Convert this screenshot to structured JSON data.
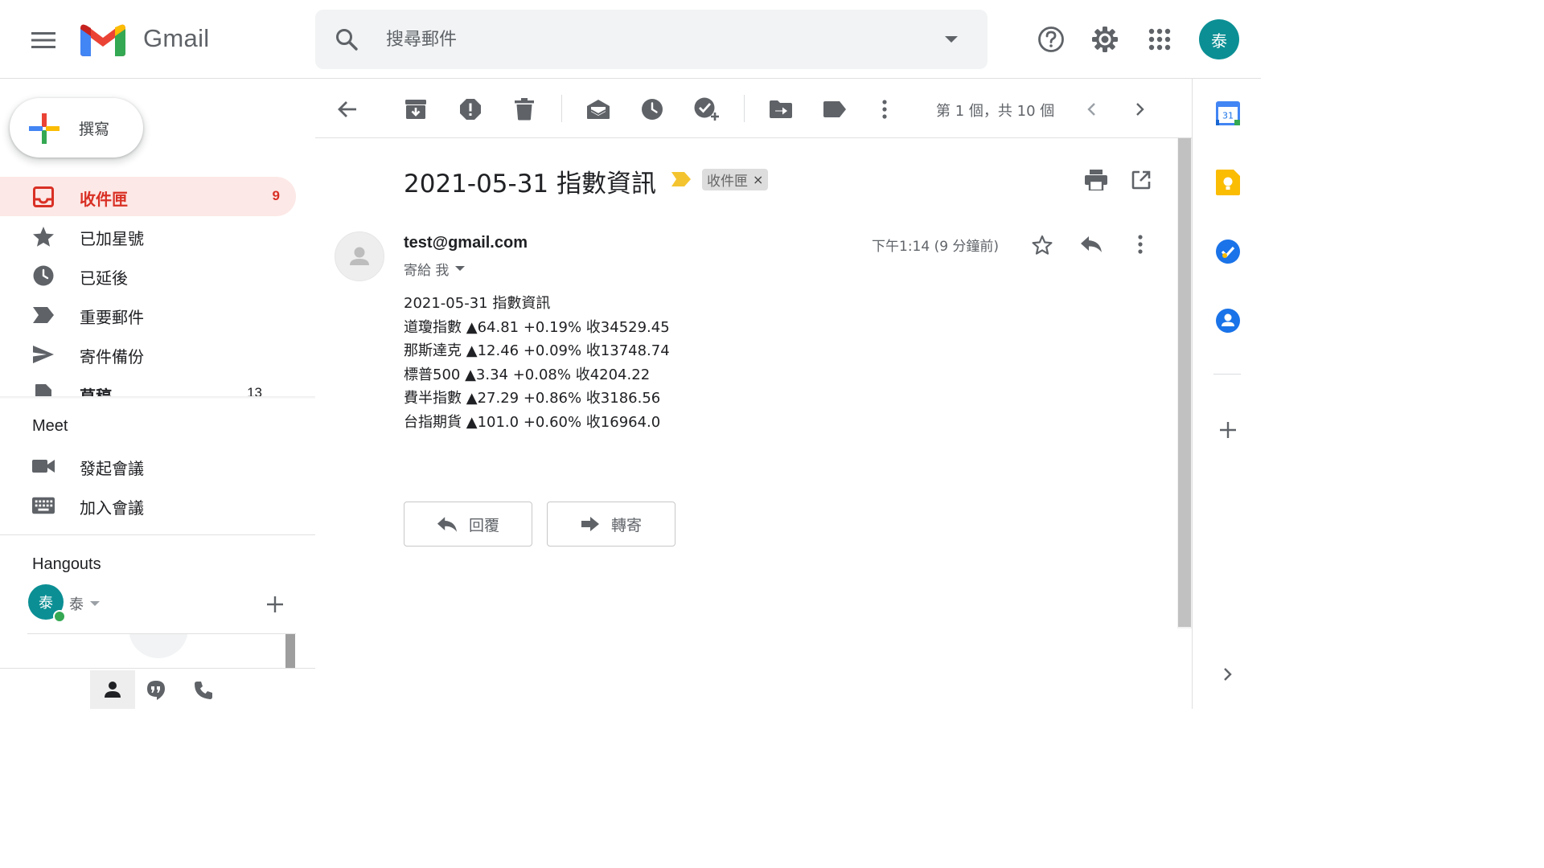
{
  "app": {
    "name": "Gmail",
    "avatar_initial": "泰"
  },
  "colors": {
    "accent_red": "#d93025",
    "avatar_teal": "#0b8f94",
    "important_yellow": "#f4c430"
  },
  "search": {
    "placeholder": "搜尋郵件"
  },
  "compose": {
    "label": "撰寫"
  },
  "nav": [
    {
      "label": "收件匣",
      "count": "9",
      "icon": "inbox-icon",
      "active": true
    },
    {
      "label": "已加星號",
      "count": "",
      "icon": "star-icon"
    },
    {
      "label": "已延後",
      "count": "",
      "icon": "clock-icon"
    },
    {
      "label": "重要郵件",
      "count": "",
      "icon": "important-icon"
    },
    {
      "label": "寄件備份",
      "count": "",
      "icon": "send-icon"
    },
    {
      "label": "草稿",
      "count": "13",
      "icon": "draft-icon"
    }
  ],
  "meet": {
    "title": "Meet",
    "items": [
      {
        "label": "發起會議",
        "icon": "video-icon"
      },
      {
        "label": "加入會議",
        "icon": "keyboard-icon"
      }
    ]
  },
  "hangouts": {
    "title": "Hangouts",
    "user": "泰",
    "user_initial": "泰"
  },
  "toolbar": {
    "pager": "第 1 個，共 10 個"
  },
  "message": {
    "subject": "2021-05-31 指數資訊",
    "label_chip": "收件匣",
    "label_chip_close": "×",
    "sender": "test@gmail.com",
    "to": "寄給 我",
    "time": "下午1:14 (9 分鐘前)",
    "body": [
      "2021-05-31 指數資訊",
      "道瓊指數 ▲64.81 +0.19% 收34529.45",
      "那斯達克 ▲12.46 +0.09% 收13748.74",
      "標普500 ▲3.34 +0.08% 收4204.22",
      "費半指數 ▲27.29 +0.86% 收3186.56",
      "台指期貨 ▲101.0 +0.60% 收16964.0"
    ],
    "reply_label": "回覆",
    "forward_label": "轉寄"
  },
  "side_panel": {
    "calendar_day": "31"
  }
}
